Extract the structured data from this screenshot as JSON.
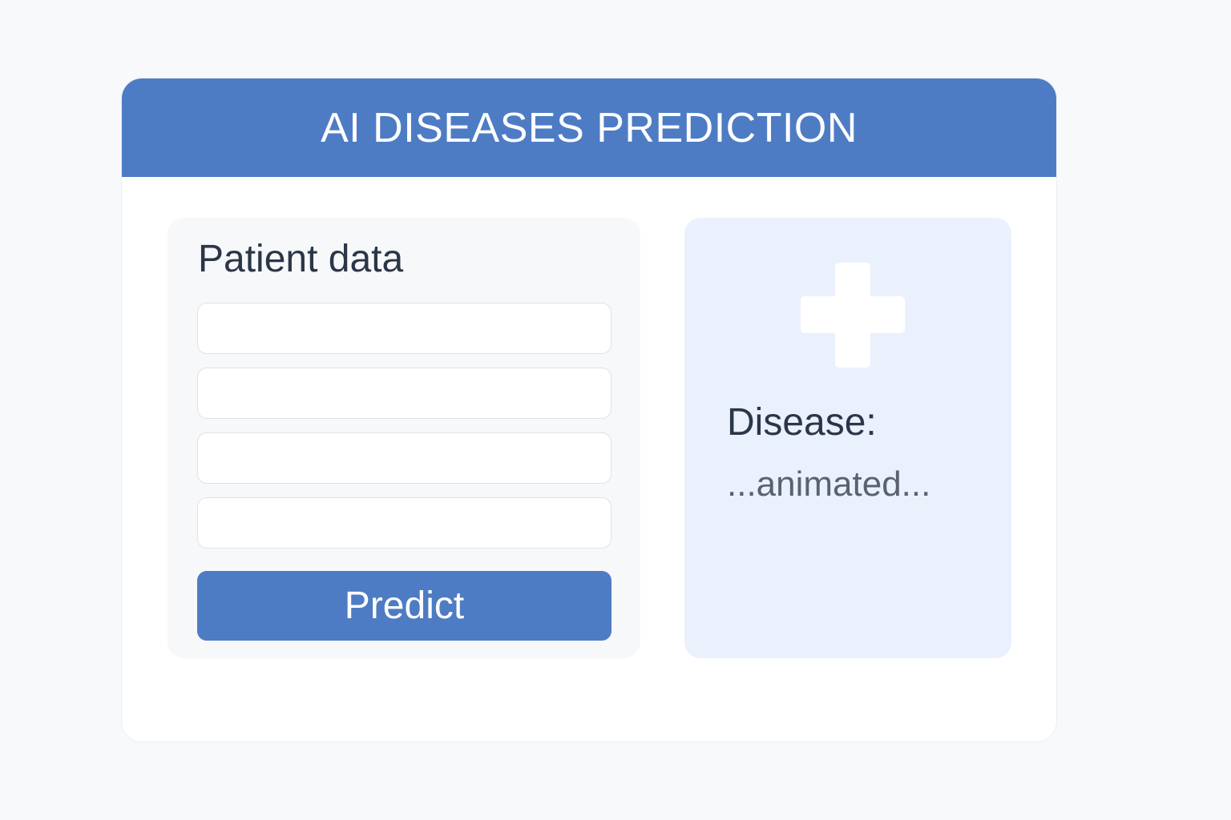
{
  "header": {
    "title": "AI DISEASES PREDICTION"
  },
  "patient_form": {
    "title": "Patient data",
    "fields": [
      {
        "value": "",
        "placeholder": ""
      },
      {
        "value": "",
        "placeholder": ""
      },
      {
        "value": "",
        "placeholder": ""
      },
      {
        "value": "",
        "placeholder": ""
      }
    ],
    "predict_label": "Predict"
  },
  "result": {
    "icon": "medical-cross-icon",
    "label": "Disease:",
    "value": "...animated..."
  },
  "colors": {
    "accent": "#4e7cc4",
    "result_background": "#eaf1fd",
    "page_background": "#f8f9fa"
  }
}
